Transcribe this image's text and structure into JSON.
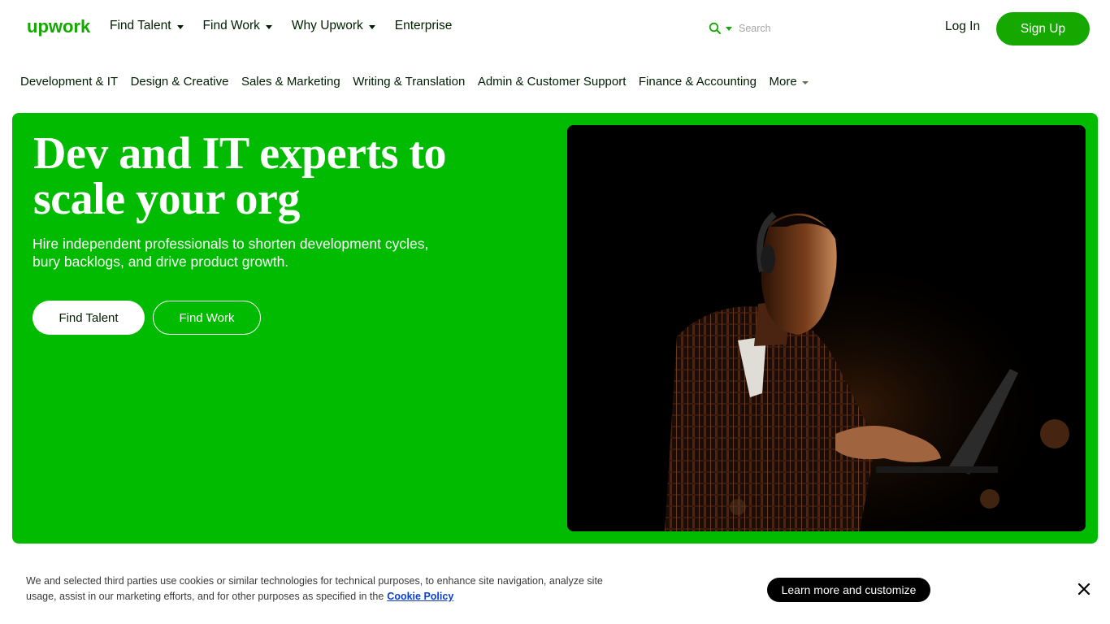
{
  "header": {
    "logo_text": "upwork",
    "nav": [
      {
        "label": "Find Talent",
        "has_dropdown": true
      },
      {
        "label": "Find Work",
        "has_dropdown": true
      },
      {
        "label": "Why Upwork",
        "has_dropdown": true
      },
      {
        "label": "Enterprise",
        "has_dropdown": false
      }
    ],
    "search": {
      "placeholder": "Search",
      "icon": "search-icon"
    },
    "login_label": "Log In",
    "signup_label": "Sign Up"
  },
  "categories": [
    "Development & IT",
    "Design & Creative",
    "Sales & Marketing",
    "Writing & Translation",
    "Admin & Customer Support",
    "Finance & Accounting",
    "More"
  ],
  "hero": {
    "title": "Dev and IT experts to scale your org",
    "subtitle": "Hire independent professionals to shorten development cycles, bury backlogs, and drive product growth.",
    "primary_button": "Find Talent",
    "secondary_button": "Find Work"
  },
  "cookie_banner": {
    "text": "We and selected third parties use cookies or similar technologies for technical purposes, to enhance site navigation, analyze site usage, assist in our marketing efforts, and for other purposes as specified in the",
    "link_label": "Cookie Policy",
    "button_label": "Learn more and customize",
    "close_icon": "close-icon"
  },
  "colors": {
    "brand_green": "#14a800",
    "hero_green": "#00bb00",
    "text_dark": "#001e00",
    "link_blue": "#0a40d0"
  }
}
